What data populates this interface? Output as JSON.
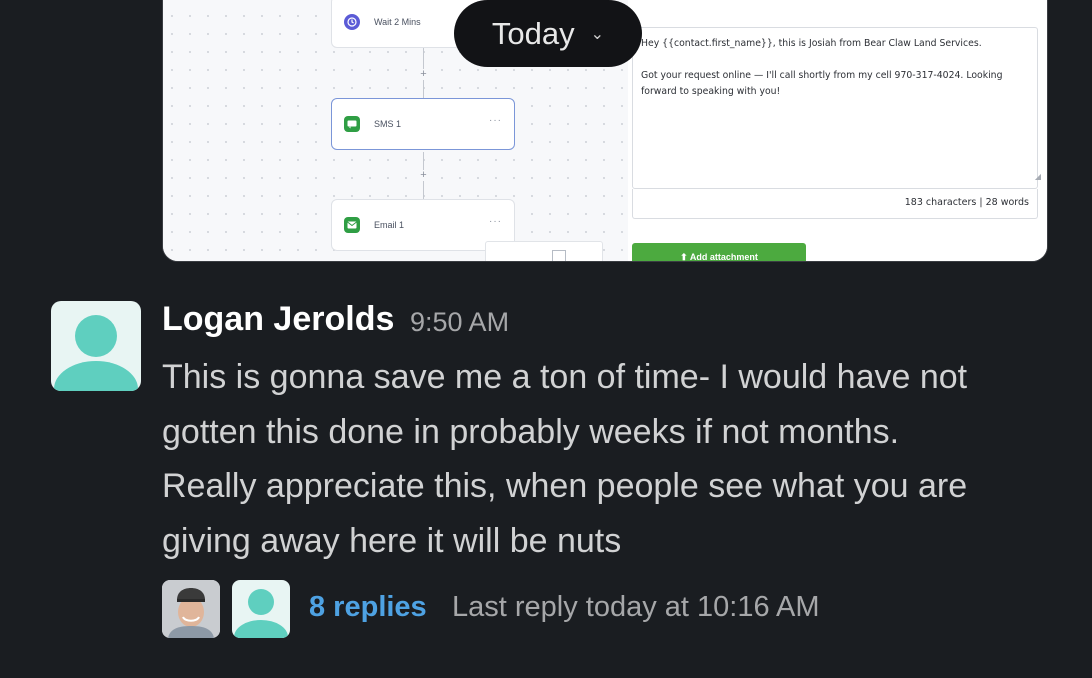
{
  "embedded_screenshot": {
    "workflow_nodes": [
      {
        "label": "Wait 2 Mins",
        "icon": "clock-icon",
        "icon_color": "#5b5bd6"
      },
      {
        "label": "SMS 1",
        "icon": "message-icon",
        "icon_color": "#2f9e44"
      },
      {
        "label": "Email 1",
        "icon": "mail-icon",
        "icon_color": "#2f9e44"
      }
    ],
    "node_more": "···",
    "plus_symbol": "+",
    "editor_line1": "Hey {{contact.first_name}}, this is Josiah from Bear Claw Land Services.",
    "editor_line2": "Got your request online — I'll call shortly from my cell 970-317-4024. Looking forward to speaking with you!",
    "char_count": "183 characters | 28 words",
    "attach_button": "⬆ Add attachment"
  },
  "date_divider": {
    "label": "Today",
    "chevron": "⌄"
  },
  "message": {
    "author": "Logan Jerolds",
    "time": "9:50 AM",
    "lines": [
      "This is gonna save me a ton of time- I would have not",
      "gotten this done in probably weeks if not months.",
      "Really appreciate this, when people see what you are",
      "giving away here it will be nuts"
    ],
    "avatar_color": "#5fcfbf"
  },
  "thread": {
    "replies": "8 replies",
    "last_reply": "Last reply today at 10:16 AM"
  },
  "colors": {
    "link": "#4ea2e3",
    "background": "#1a1d21"
  }
}
